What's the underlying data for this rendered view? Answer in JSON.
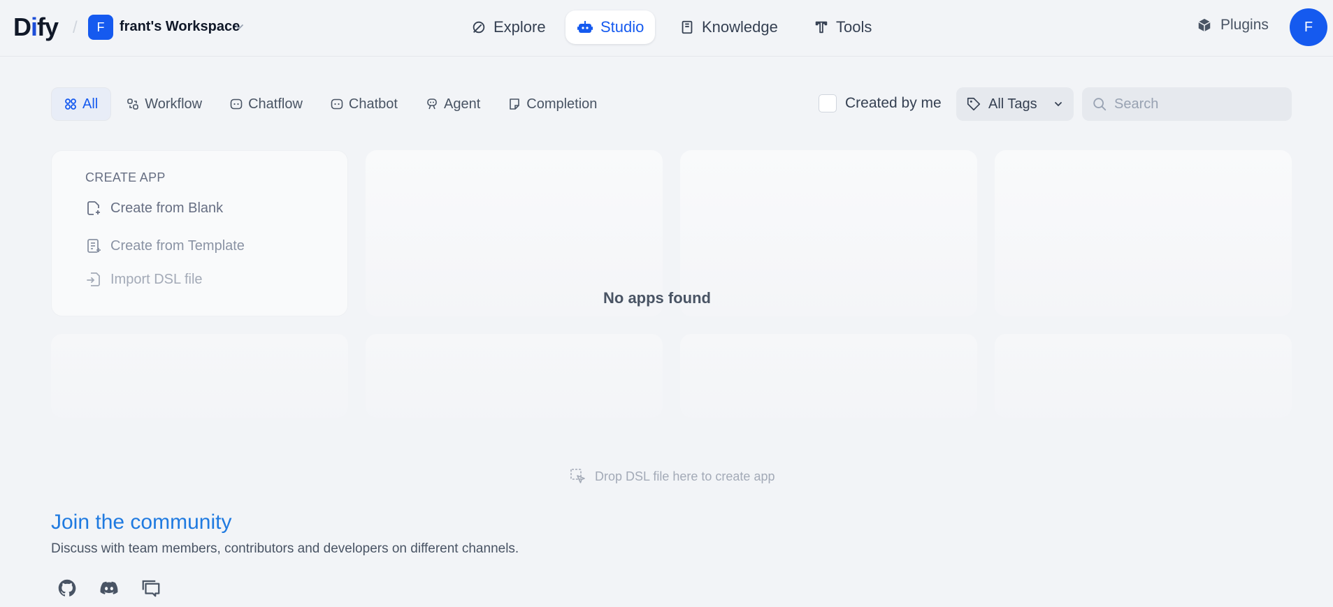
{
  "header": {
    "logo": {
      "part1": "D",
      "part2": "i",
      "part3": "fy"
    },
    "workspace": {
      "initial": "F",
      "name": "frant's Workspace"
    },
    "nav": [
      {
        "label": "Explore",
        "icon": "explore-icon"
      },
      {
        "label": "Studio",
        "icon": "robot-icon",
        "active": true
      },
      {
        "label": "Knowledge",
        "icon": "book-icon"
      },
      {
        "label": "Tools",
        "icon": "tools-icon"
      }
    ],
    "plugins_label": "Plugins",
    "avatar_initial": "F"
  },
  "filters": {
    "tabs": [
      {
        "label": "All",
        "icon": "grid-icon",
        "active": true
      },
      {
        "label": "Workflow",
        "icon": "workflow-icon"
      },
      {
        "label": "Chatflow",
        "icon": "chatflow-icon"
      },
      {
        "label": "Chatbot",
        "icon": "chatbot-icon"
      },
      {
        "label": "Agent",
        "icon": "agent-icon"
      },
      {
        "label": "Completion",
        "icon": "completion-icon"
      }
    ],
    "created_by_me": "Created by me",
    "tags_label": "All Tags",
    "search_placeholder": "Search"
  },
  "create_app": {
    "title": "CREATE APP",
    "blank": "Create from Blank",
    "template": "Create from Template",
    "import": "Import DSL file"
  },
  "empty_state": "No apps found",
  "drop_hint": "Drop DSL file here to create app",
  "community": {
    "title": "Join the community",
    "description": "Discuss with team members, contributors and developers on different channels."
  },
  "colors": {
    "accent": "#155aef",
    "link": "#1f7ae0",
    "background": "#f2f4f7"
  }
}
